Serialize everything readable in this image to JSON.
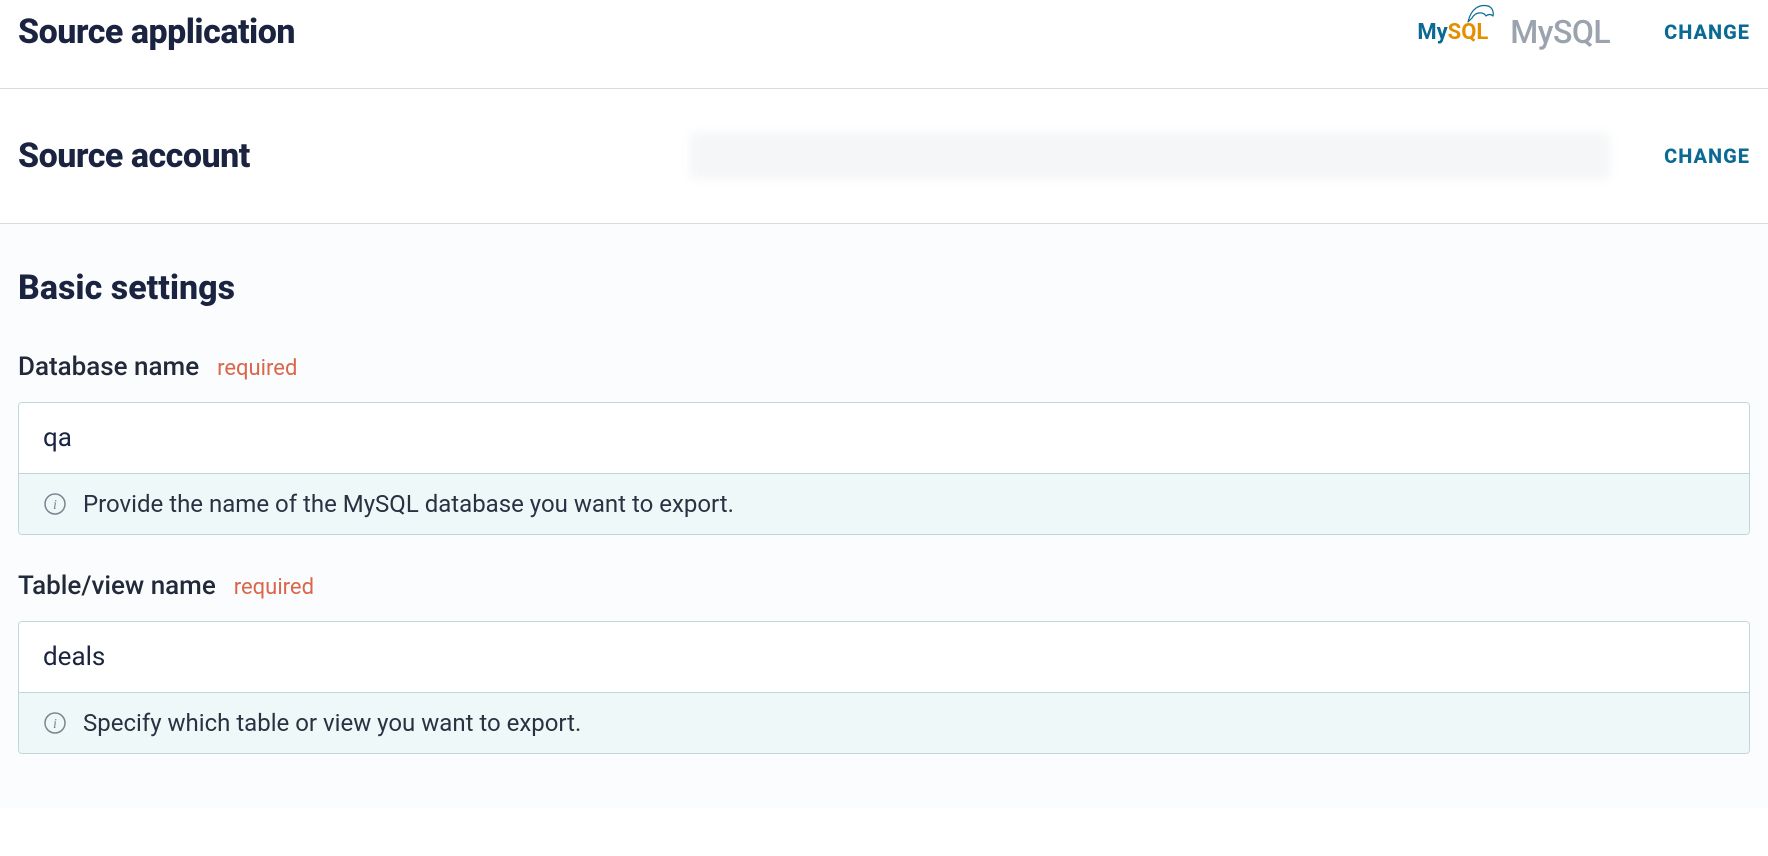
{
  "source_app": {
    "heading": "Source application",
    "logo_my": "My",
    "logo_sql": "SQL",
    "name": "MySQL",
    "change_label": "CHANGE"
  },
  "source_account": {
    "heading": "Source account",
    "change_label": "CHANGE"
  },
  "settings": {
    "heading": "Basic settings",
    "required_tag": "required",
    "database": {
      "label": "Database name",
      "value": "qa",
      "help": "Provide the name of the MySQL database you want to export."
    },
    "table": {
      "label": "Table/view name",
      "value": "deals",
      "help": "Specify which table or view you want to export."
    }
  }
}
